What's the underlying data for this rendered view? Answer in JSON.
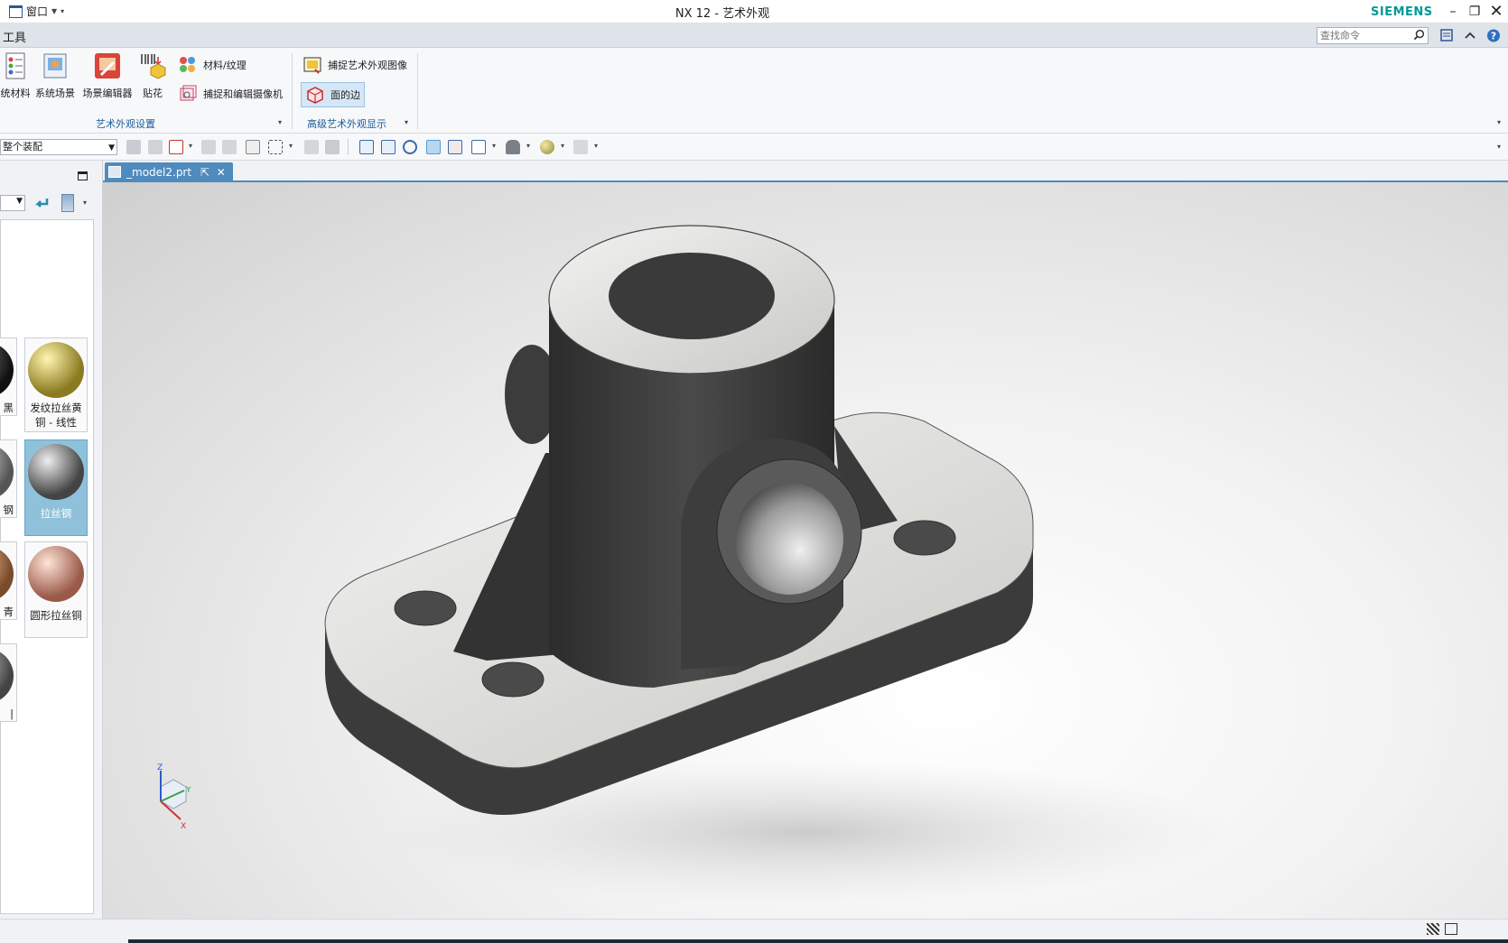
{
  "window": {
    "title": "NX 12 - 艺术外观",
    "menu_label": "窗口",
    "brand": "SIEMENS"
  },
  "menubar": {
    "tools_label": "工具",
    "search_placeholder": "查找命令"
  },
  "ribbon": {
    "group1": {
      "buttons": [
        {
          "label": "统材料",
          "icon": "system-material-icon"
        },
        {
          "label": "系统场景",
          "icon": "system-scene-icon"
        },
        {
          "label": "场景编辑器",
          "icon": "scene-editor-icon"
        },
        {
          "label": "贴花",
          "icon": "decal-icon"
        }
      ],
      "small": [
        {
          "label": "材料/纹理",
          "icon": "material-texture-icon"
        },
        {
          "label": "捕捉和编辑摄像机",
          "icon": "camera-capture-icon"
        }
      ],
      "label": "艺术外观设置"
    },
    "group2": {
      "small": [
        {
          "label": "捕捉艺术外观图像",
          "icon": "capture-image-icon"
        },
        {
          "label": "面的边",
          "icon": "face-edges-icon"
        }
      ],
      "label": "高级艺术外观显示"
    }
  },
  "toolbar": {
    "assembly_select": "整个装配"
  },
  "materials": {
    "tiles": [
      {
        "label": "黑",
        "col": "left",
        "row": 0
      },
      {
        "label": "发纹拉丝黄铜 - 线性",
        "col": "right",
        "row": 0,
        "color": "#b9a33a"
      },
      {
        "label": "钢",
        "col": "left",
        "row": 1
      },
      {
        "label": "拉丝钢",
        "col": "right",
        "row": 1,
        "color": "#8a8a8a",
        "selected": true
      },
      {
        "label": "青",
        "col": "left",
        "row": 2
      },
      {
        "label": "圆形拉丝铜",
        "col": "right",
        "row": 2,
        "color": "#c98f7a"
      },
      {
        "label": "|",
        "col": "left",
        "row": 3
      }
    ]
  },
  "document": {
    "tab_label": "_model2.prt"
  },
  "axes": {
    "x": "X",
    "y": "Y",
    "z": "Z"
  }
}
